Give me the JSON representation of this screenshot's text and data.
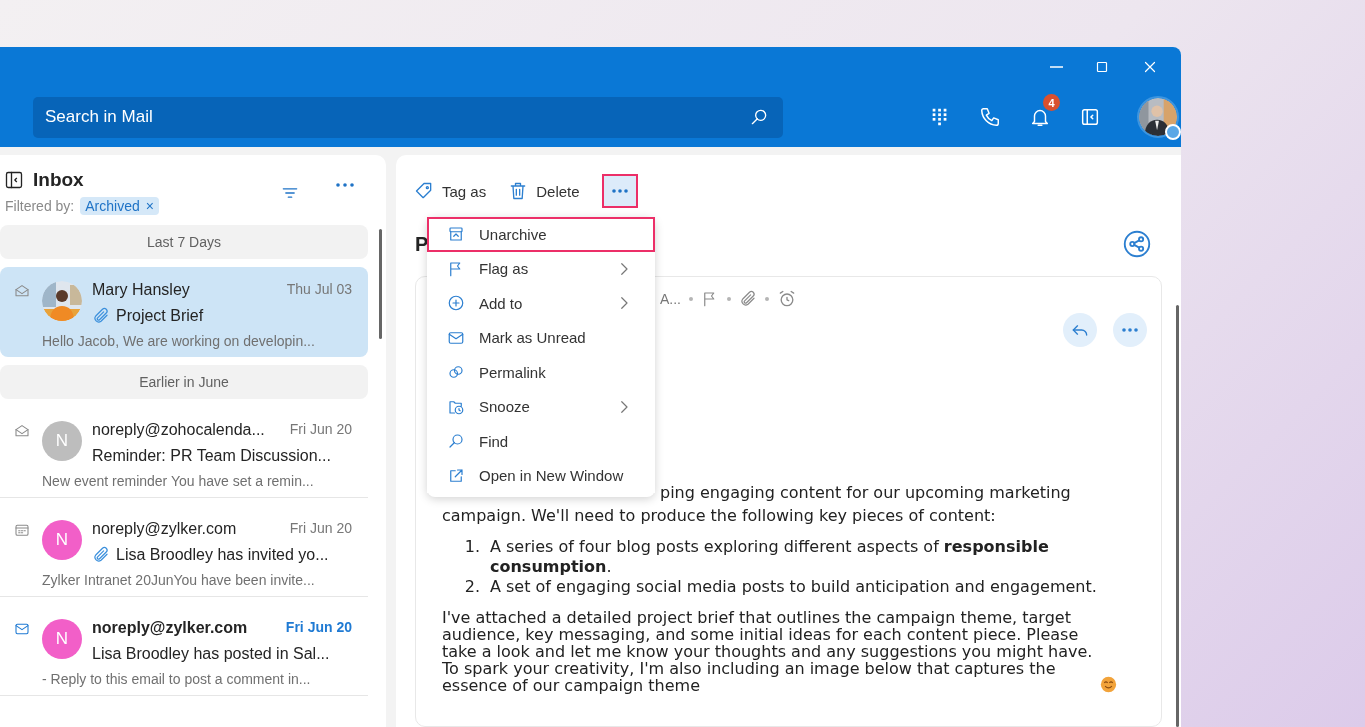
{
  "search": {
    "placeholder": "Search in Mail"
  },
  "header": {
    "notification_count": "4"
  },
  "folder": {
    "title": "Inbox",
    "filter_label": "Filtered by:",
    "filter_chip": "Archived",
    "chip_remove": "×"
  },
  "mail_list": [
    {
      "kind": "group",
      "label": "Last 7 Days"
    },
    {
      "kind": "mail",
      "calendar_event": false,
      "unread": false,
      "selected": true,
      "sender": "Mary Hansley",
      "date": "Thu Jul 03",
      "attachment": true,
      "subject": "Project Brief",
      "preview": "Hello Jacob, We are working on developin..."
    },
    {
      "kind": "group",
      "label": "Earlier in  June"
    },
    {
      "kind": "mail",
      "calendar_event": false,
      "unread": false,
      "selected": false,
      "avatar": {
        "kind": "letter",
        "letter": "N",
        "color": "#bdbdbd"
      },
      "sender": "noreply@zohocalenda...",
      "date": "Fri Jun 20",
      "attachment": false,
      "subject": "Reminder: PR Team Discussion...",
      "preview": "New event reminder You have set a remin..."
    },
    {
      "kind": "mail",
      "calendar_event": true,
      "unread": false,
      "selected": false,
      "avatar": {
        "kind": "letter",
        "letter": "N",
        "color": "#f25fc8"
      },
      "sender": "noreply@zylker.com",
      "date": "Fri Jun 20",
      "attachment": true,
      "subject": "Lisa Broodley has invited yo...",
      "preview": "Zylker Intranet 20JunYou have been invite..."
    },
    {
      "kind": "mail",
      "calendar_event": false,
      "unread": true,
      "selected": false,
      "avatar": {
        "kind": "letter",
        "letter": "N",
        "color": "#f25fc8"
      },
      "sender": "noreply@zylker.com",
      "date": "Fri Jun 20",
      "attachment": false,
      "subject": "Lisa Broodley has posted in Sal...",
      "preview": "- Reply to this email to post a comment in..."
    }
  ],
  "toolbar": {
    "actions": [
      {
        "label": "Tag as"
      },
      {
        "label": "Delete"
      }
    ],
    "more_selected": true
  },
  "message": {
    "subject": "P",
    "meta": "A...",
    "body_intro": "ping engaging content for our upcoming marketing campaign. We'll need to produce the following key pieces of content:",
    "list": [
      {
        "marker": "1.",
        "text": "A series of four blog posts exploring different aspects of **responsible consumption**."
      },
      {
        "marker": "2.",
        "text": "A set of engaging social media posts to build anticipation and engagement."
      }
    ],
    "body_text": "I've attached a detailed project brief that outlines the campaign theme, target audience, key messaging, and some initial ideas for each content piece. Please take a look and let me know your thoughts and any suggestions you might have. To spark your creativity, I'm also including an image below that captures the essence of our campaign theme"
  },
  "menu": [
    {
      "label": "Unarchive",
      "submenu": false,
      "selected": true
    },
    {
      "label": "Flag as",
      "submenu": true,
      "selected": false
    },
    {
      "label": "Add to",
      "submenu": true,
      "selected": false
    },
    {
      "label": "Mark as Unread",
      "submenu": false,
      "selected": false
    },
    {
      "label": "Permalink",
      "submenu": false,
      "selected": false
    },
    {
      "label": "Snooze",
      "submenu": true,
      "selected": false
    },
    {
      "label": "Find",
      "submenu": false,
      "selected": false
    },
    {
      "label": "Open in New Window",
      "submenu": false,
      "selected": false
    }
  ]
}
